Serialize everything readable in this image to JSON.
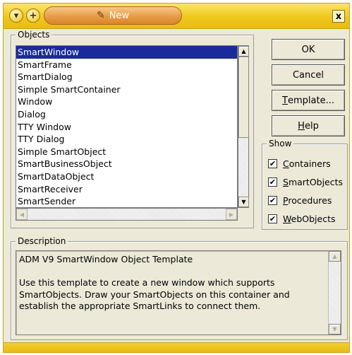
{
  "title_bar": {
    "menu_icon": "chevron-down-icon",
    "add_icon": "plus-icon",
    "pill_icon": "pencil-icon",
    "pill_label": "New",
    "close_label": "x"
  },
  "objects": {
    "label": "Objects",
    "items": [
      "SmartWindow",
      "SmartFrame",
      "SmartDialog",
      "Simple SmartContainer",
      "Window",
      "Dialog",
      "TTY Window",
      "TTY Dialog",
      "Simple SmartObject",
      "SmartBusinessObject",
      "SmartDataObject",
      "SmartReceiver",
      "SmartSender"
    ],
    "selected": "SmartWindow"
  },
  "buttons": {
    "ok": "OK",
    "cancel": "Cancel",
    "template_u": "T",
    "template_rest": "emplate...",
    "help_u": "H",
    "help_rest": "elp"
  },
  "show": {
    "label": "Show",
    "options": [
      {
        "u": "C",
        "rest": "ontainers",
        "checked": true
      },
      {
        "u": "S",
        "rest": "martObjects",
        "checked": true
      },
      {
        "u": "P",
        "rest": "rocedures",
        "checked": true
      },
      {
        "u": "W",
        "rest": "ebObjects",
        "checked": true
      }
    ]
  },
  "description": {
    "label": "Description",
    "text": "ADM V9 SmartWindow Object Template\n\nUse this template to create a new window which supports SmartObjects. Draw your SmartObjects on this container and establish the appropriate SmartLinks to connect them."
  },
  "colors": {
    "titlebar": "#f0c81c",
    "pill": "#e79c47",
    "selection": "#1a2a9a",
    "dialog_bg": "#ece9d8"
  }
}
